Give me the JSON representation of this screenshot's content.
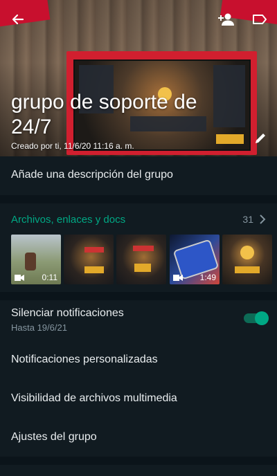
{
  "header": {
    "title": "grupo de soporte de 24/7",
    "created": "Creado por ti, 11/6/20 11:16 a. m.",
    "icons": [
      "back-arrow-icon",
      "add-participant-icon",
      "label-icon",
      "edit-pencil-icon"
    ]
  },
  "description": {
    "add_label": "Añade una descripción del grupo"
  },
  "media": {
    "title": "Archivos, enlaces y docs",
    "count": "31",
    "thumbnails": [
      {
        "duration": "0:11",
        "is_video": true
      },
      {
        "duration": "",
        "is_video": false
      },
      {
        "duration": "",
        "is_video": false
      },
      {
        "duration": "1:49",
        "is_video": true
      },
      {
        "duration": "",
        "is_video": false
      }
    ]
  },
  "settings": {
    "mute_label": "Silenciar notificaciones",
    "mute_sub": "Hasta 19/6/21",
    "mute_on": true,
    "custom_notifications": "Notificaciones personalizadas",
    "media_visibility": "Visibilidad de archivos multimedia",
    "group_settings": "Ajustes del grupo"
  },
  "colors": {
    "accent": "#00a884",
    "background": "#0b141a",
    "panel": "#111b21"
  }
}
